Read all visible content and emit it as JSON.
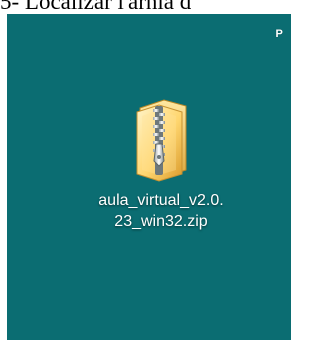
{
  "document": {
    "top_text": "5- Localizar l'arnia d",
    "corner_text": "P"
  },
  "desktop": {
    "background": "#0b6d72",
    "item": {
      "icon": "zip-folder-icon",
      "name_line_1": "aula_virtual_v2.0.",
      "name_line_2": "23_win32.zip"
    }
  }
}
